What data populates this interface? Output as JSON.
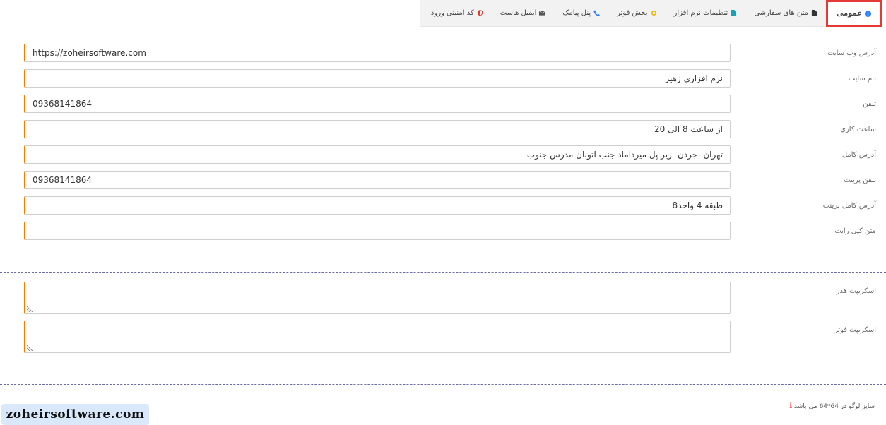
{
  "tabs": [
    {
      "label": "عمومی",
      "icon": "info-circle-icon",
      "icon_color": "#2a7fff",
      "active": true
    },
    {
      "label": "متن های سفارشی",
      "icon": "file-icon",
      "icon_color": "#333333",
      "active": false
    },
    {
      "label": "تنظیمات نرم افزار",
      "icon": "file-icon",
      "icon_color": "#17a2b8",
      "active": false
    },
    {
      "label": "بخش فوتر",
      "icon": "sun-icon",
      "icon_color": "#f5b800",
      "active": false
    },
    {
      "label": "پنل پیامک",
      "icon": "phone-icon",
      "icon_color": "#2a7fff",
      "active": false
    },
    {
      "label": "ایمیل هاست",
      "icon": "envelope-icon",
      "icon_color": "#555555",
      "active": false
    },
    {
      "label": "کد امنیتی ورود",
      "icon": "shield-icon",
      "icon_color": "#e53935",
      "active": false
    }
  ],
  "fields": [
    {
      "label": "آدرس وب سایت",
      "value": "https://zoheirsoftware.com",
      "dir": "ltr"
    },
    {
      "label": "نام سایت",
      "value": "نرم افزاری زهیر",
      "dir": "rtl"
    },
    {
      "label": "تلفن",
      "value": "09368141864",
      "dir": "ltr"
    },
    {
      "label": "ساعت کاری",
      "value": "از ساعت 8 الی 20",
      "dir": "rtl"
    },
    {
      "label": "آدرس کامل",
      "value": "تهران -جردن -زیر پل میرداماد جنب اتوبان مدرس جنوب-",
      "dir": "rtl"
    },
    {
      "label": "تلفن پرینت",
      "value": "09368141864",
      "dir": "ltr"
    },
    {
      "label": "آدرس کامل پرینت",
      "value": "طبقه 4 واحد8",
      "dir": "rtl"
    },
    {
      "label": "متن کپی رایت",
      "value": "",
      "dir": "rtl"
    }
  ],
  "scripts": [
    {
      "label": "اسکریپت هدر",
      "value": ""
    },
    {
      "label": "اسکریپت فوتر",
      "value": ""
    }
  ],
  "note": {
    "icon": "i",
    "text": "سایز لوگو در 64*64 می باشد."
  },
  "watermark": "zoheirsoftware.com",
  "colors": {
    "accent": "#f57c00",
    "highlight": "#e53935",
    "divider": "#6a6aa8"
  }
}
